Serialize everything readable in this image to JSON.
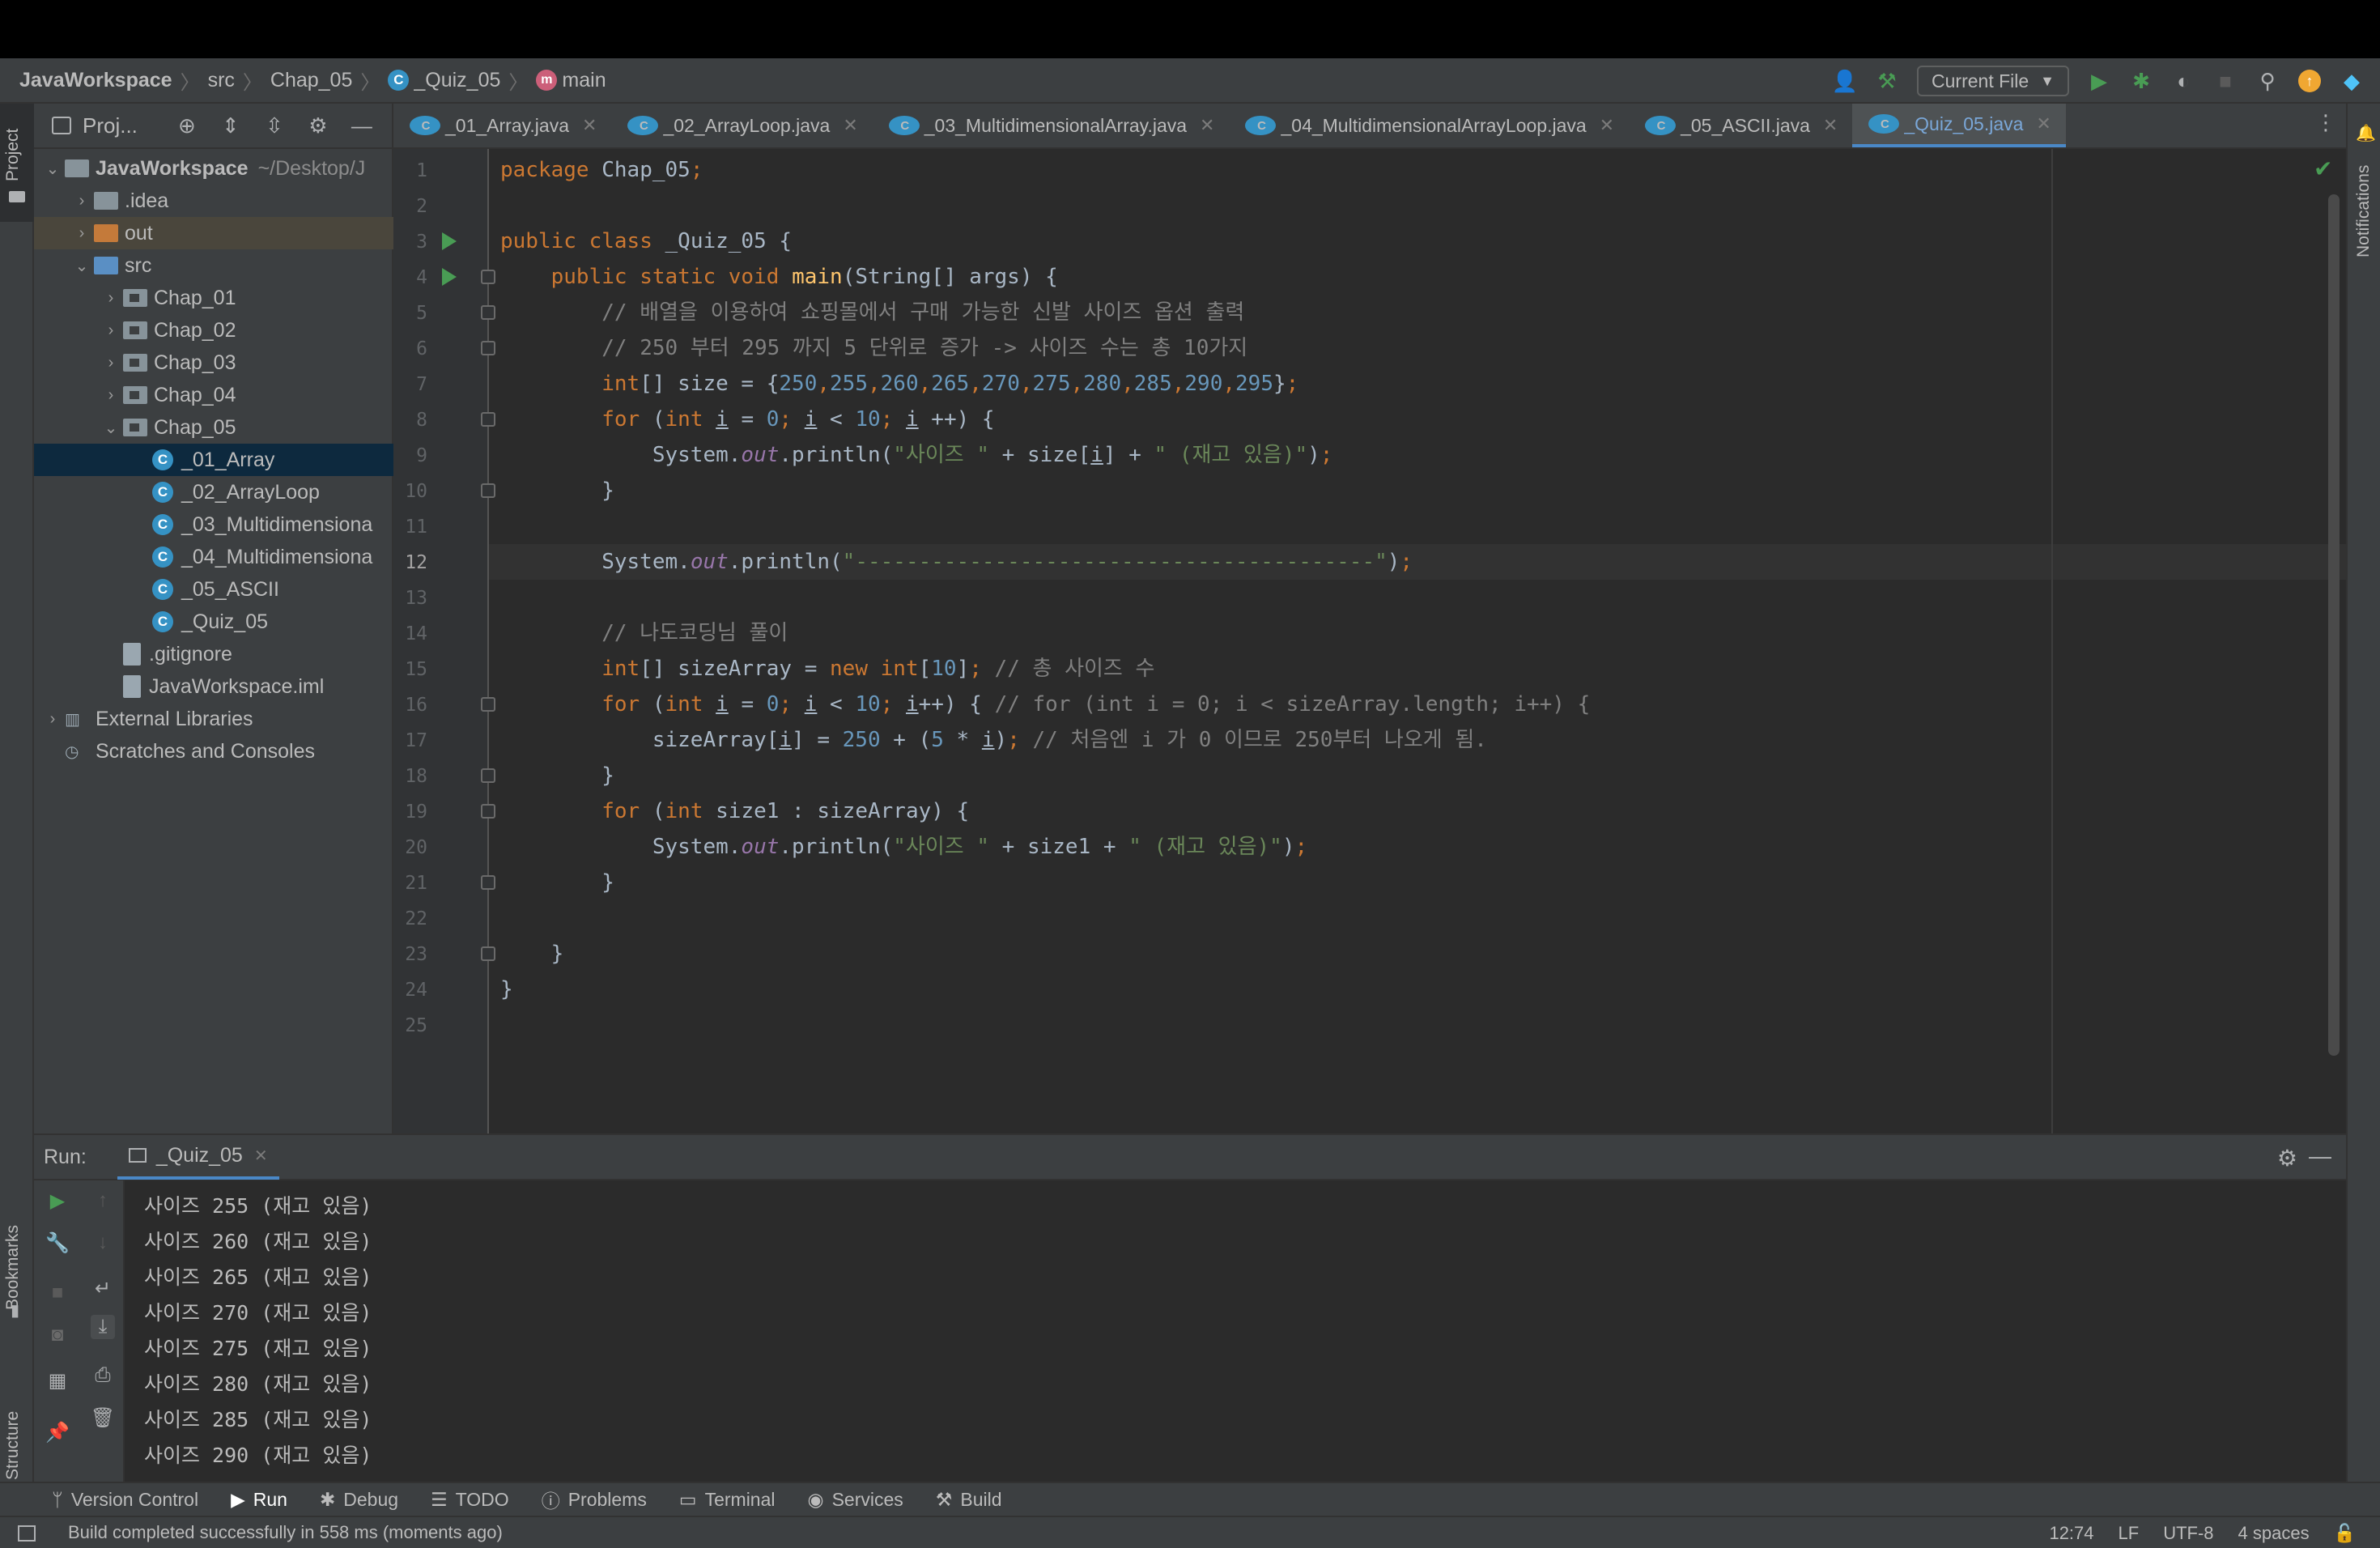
{
  "breadcrumb": {
    "project": "JavaWorkspace",
    "src": "src",
    "package": "Chap_05",
    "class": "_Quiz_05",
    "method": "main"
  },
  "toolbar": {
    "run_config": "Current File"
  },
  "project_panel": {
    "title": "Proj...",
    "tree": [
      {
        "label": "JavaWorkspace",
        "path": "~/Desktop/J",
        "depth": 0,
        "kind": "module",
        "expanded": true
      },
      {
        "label": ".idea",
        "depth": 1,
        "kind": "folder",
        "expanded": false
      },
      {
        "label": "out",
        "depth": 1,
        "kind": "folder-orange",
        "expanded": false
      },
      {
        "label": "src",
        "depth": 1,
        "kind": "folder-blue",
        "expanded": true
      },
      {
        "label": "Chap_01",
        "depth": 2,
        "kind": "package",
        "expanded": false
      },
      {
        "label": "Chap_02",
        "depth": 2,
        "kind": "package",
        "expanded": false
      },
      {
        "label": "Chap_03",
        "depth": 2,
        "kind": "package",
        "expanded": false
      },
      {
        "label": "Chap_04",
        "depth": 2,
        "kind": "package",
        "expanded": false
      },
      {
        "label": "Chap_05",
        "depth": 2,
        "kind": "package",
        "expanded": true
      },
      {
        "label": "_01_Array",
        "depth": 3,
        "kind": "class"
      },
      {
        "label": "_02_ArrayLoop",
        "depth": 3,
        "kind": "class"
      },
      {
        "label": "_03_Multidimensiona",
        "depth": 3,
        "kind": "class"
      },
      {
        "label": "_04_Multidimensiona",
        "depth": 3,
        "kind": "class"
      },
      {
        "label": "_05_ASCII",
        "depth": 3,
        "kind": "class"
      },
      {
        "label": "_Quiz_05",
        "depth": 3,
        "kind": "class"
      },
      {
        "label": ".gitignore",
        "depth": 2,
        "kind": "file"
      },
      {
        "label": "JavaWorkspace.iml",
        "depth": 2,
        "kind": "file"
      },
      {
        "label": "External Libraries",
        "depth": 0,
        "kind": "library",
        "expanded": false
      },
      {
        "label": "Scratches and Consoles",
        "depth": 0,
        "kind": "scratch"
      }
    ]
  },
  "editor_tabs": [
    {
      "label": "_01_Array.java",
      "active": false
    },
    {
      "label": "_02_ArrayLoop.java",
      "active": false
    },
    {
      "label": "_03_MultidimensionalArray.java",
      "active": false
    },
    {
      "label": "_04_MultidimensionalArrayLoop.java",
      "active": false
    },
    {
      "label": "_05_ASCII.java",
      "active": false
    },
    {
      "label": "_Quiz_05.java",
      "active": true
    }
  ],
  "editor": {
    "current_line": 12,
    "lines": [
      "package Chap_05;",
      "",
      "public class _Quiz_05 {",
      "    public static void main(String[] args) {",
      "        // 배열을 이용하여 쇼핑몰에서 구매 가능한 신발 사이즈 옵션 출력",
      "        // 250 부터 295 까지 5 단위로 증가 -> 사이즈 수는 총 10가지",
      "        int[] size = {250,255,260,265,270,275,280,285,290,295};",
      "        for (int i = 0; i < 10; i ++) {",
      "            System.out.println(\"사이즈 \" + size[i] + \" (재고 있음)\");",
      "        }",
      "",
      "        System.out.println(\"-----------------------------------------\");",
      "",
      "        // 나도코딩님 풀이",
      "        int[] sizeArray = new int[10]; // 총 사이즈 수",
      "        for (int i = 0; i < 10; i++) { // for (int i = 0; i < sizeArray.length; i++) {",
      "            sizeArray[i] = 250 + (5 * i); // 처음엔 i 가 0 이므로 250부터 나오게 됨.",
      "        }",
      "        for (int size1 : sizeArray) {",
      "            System.out.println(\"사이즈 \" + size1 + \" (재고 있음)\");",
      "        }",
      "",
      "    }",
      "}",
      ""
    ]
  },
  "run_panel": {
    "label": "Run:",
    "tab": "_Quiz_05",
    "output": [
      "사이즈 255 (재고 있음)",
      "사이즈 260 (재고 있음)",
      "사이즈 265 (재고 있음)",
      "사이즈 270 (재고 있음)",
      "사이즈 275 (재고 있음)",
      "사이즈 280 (재고 있음)",
      "사이즈 285 (재고 있음)",
      "사이즈 290 (재고 있음)"
    ]
  },
  "side_labels": {
    "project": "Project",
    "bookmarks": "Bookmarks",
    "structure": "Structure",
    "notifications": "Notifications"
  },
  "bottom_tabs": [
    {
      "label": "Version Control",
      "icon": "branch-icon"
    },
    {
      "label": "Run",
      "icon": "run-icon",
      "active": true
    },
    {
      "label": "Debug",
      "icon": "bug-icon"
    },
    {
      "label": "TODO",
      "icon": "list-icon"
    },
    {
      "label": "Problems",
      "icon": "info-icon"
    },
    {
      "label": "Terminal",
      "icon": "terminal-icon"
    },
    {
      "label": "Services",
      "icon": "services-icon"
    },
    {
      "label": "Build",
      "icon": "hammer-icon"
    }
  ],
  "status_bar": {
    "message": "Build completed successfully in 558 ms (moments ago)",
    "position": "12:74",
    "line_sep": "LF",
    "encoding": "UTF-8",
    "indent": "4 spaces"
  },
  "colors": {
    "accent": "#4a88c7",
    "run_green": "#499c54",
    "keyword": "#cc7832",
    "string": "#6a8759",
    "number": "#6897bb",
    "comment": "#808080"
  }
}
